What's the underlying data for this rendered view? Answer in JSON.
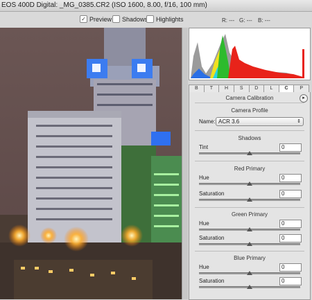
{
  "window": {
    "title": "EOS 400D Digital:  _MG_0385.CR2  (ISO 1600, 8.00, f/16, 100 mm)"
  },
  "toolbar": {
    "preview_label": "Preview",
    "preview_checked": "✓",
    "shadows_label": "Shadows",
    "highlights_label": "Highlights",
    "r_readout": "R: ---",
    "g_readout": "G: ---",
    "b_readout": "B: ---"
  },
  "tabs": [
    "B",
    "T",
    "H",
    "S",
    "D",
    "L",
    "C",
    "P"
  ],
  "active_tab": "C",
  "panel": {
    "title": "Camera Calibration",
    "profile_section": "Camera Profile",
    "name_label": "Name:",
    "name_value": "ACR 3.6",
    "shadows_section": "Shadows",
    "tint_label": "Tint",
    "tint_value": "0",
    "red_section": "Red Primary",
    "red_hue_label": "Hue",
    "red_hue_value": "0",
    "red_sat_label": "Saturation",
    "red_sat_value": "0",
    "green_section": "Green Primary",
    "green_hue_label": "Hue",
    "green_hue_value": "0",
    "green_sat_label": "Saturation",
    "green_sat_value": "0",
    "blue_section": "Blue Primary",
    "blue_hue_label": "Hue",
    "blue_hue_value": "0",
    "blue_sat_label": "Saturation",
    "blue_sat_value": "0"
  },
  "slider_levels": {
    "tint": 0.5,
    "red_hue": 0.5,
    "red_sat": 0.5,
    "green_hue": 0.5,
    "green_sat": 0.5,
    "blue_hue": 0.5,
    "blue_sat": 0.5
  },
  "colors": {
    "histogram_red": "#e8231a",
    "histogram_green": "#2dbb2d",
    "histogram_blue": "#2a6fe6",
    "histogram_yellow": "#f0e020",
    "histogram_cyan": "#28d2e6"
  }
}
